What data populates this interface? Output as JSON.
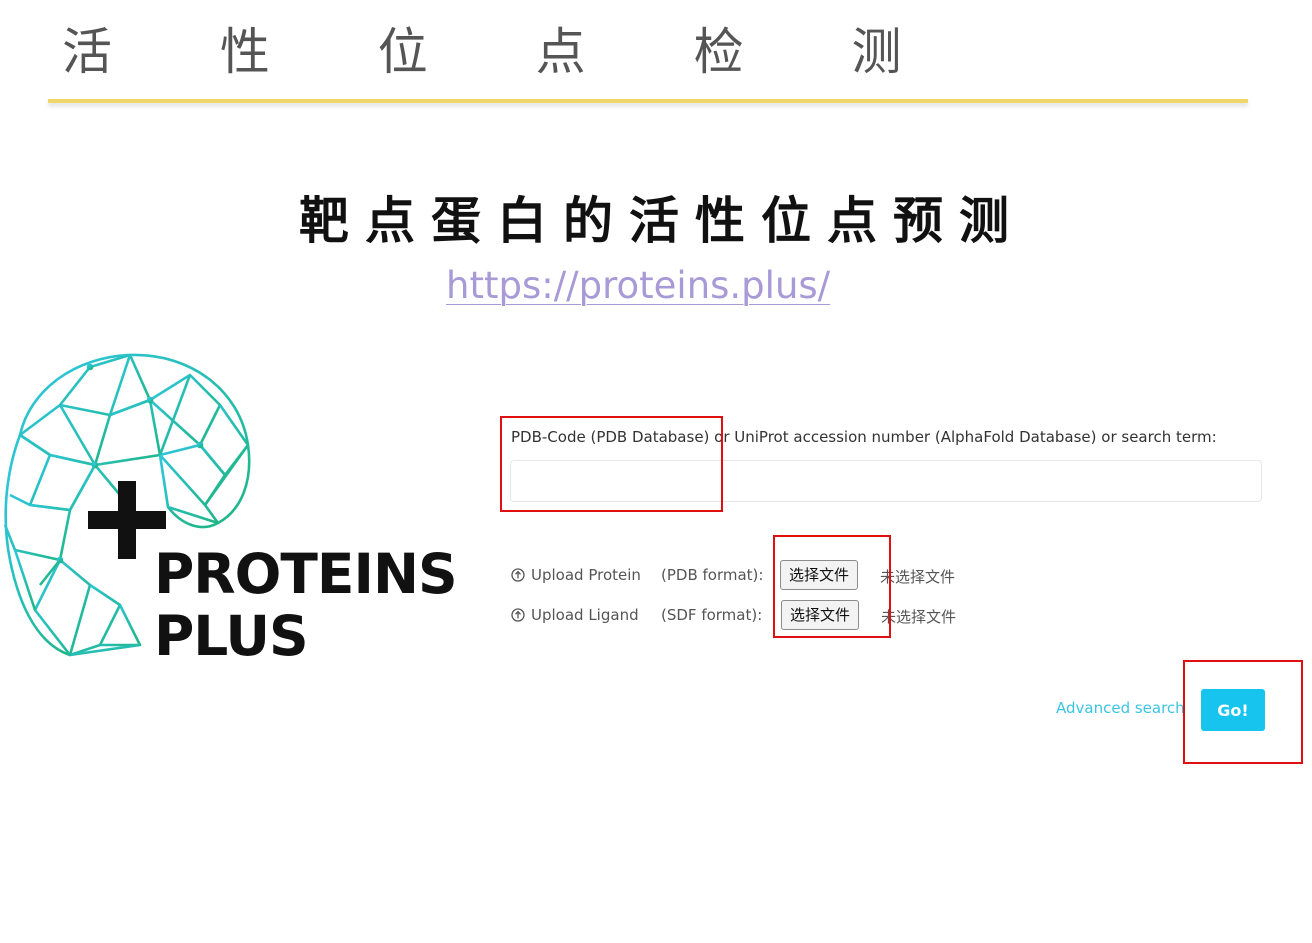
{
  "slide": {
    "title": "活 性 位 点 检 测",
    "subtitle": "靶点蛋白的活性位点预测",
    "link": "https://proteins.plus/"
  },
  "logo": {
    "line1": "PROTEINS",
    "line2": "PLUS"
  },
  "search": {
    "label": "PDB-Code (PDB Database) or UniProt accession number (AlphaFold Database) or search term:",
    "value": ""
  },
  "uploads": [
    {
      "icon": "upload-circle-icon",
      "label": "Upload Protein",
      "format": "(PDB format):",
      "button_label": "选择文件",
      "status": "未选择文件"
    },
    {
      "icon": "upload-circle-icon",
      "label": "Upload Ligand",
      "format": "(SDF format):",
      "button_label": "选择文件",
      "status": "未选择文件"
    }
  ],
  "actions": {
    "advanced_search": "Advanced search",
    "go": "Go!"
  },
  "colors": {
    "accent": "#17c4ee",
    "link": "#3bc4e3",
    "slide_link": "#a89ad6",
    "rule": "#efd66a",
    "annotation": "#e01010",
    "logo_mesh_start": "#2ec7e0",
    "logo_mesh_end": "#1fb585"
  }
}
